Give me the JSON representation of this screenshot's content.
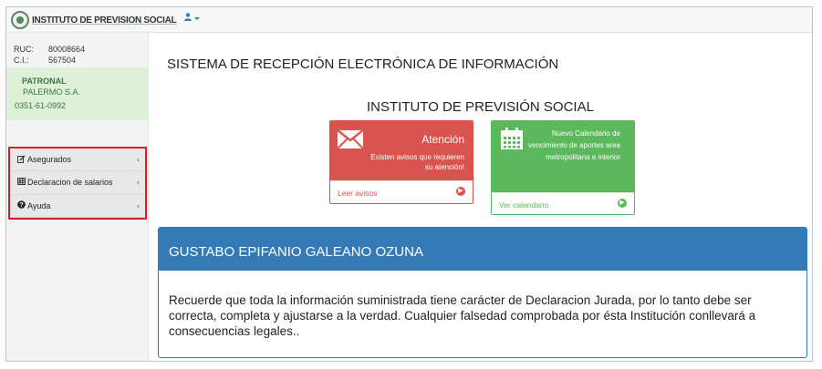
{
  "navbar": {
    "brand_text": "INSTITUTO DE PREVISION SOCIAL",
    "user_icon": "user-icon",
    "caret_icon": "caret-down-icon"
  },
  "sidebar": {
    "ruc_label": "RUC:",
    "ruc_value": "80008664",
    "ci_label": "C.I.:",
    "ci_value": "567504",
    "patronal_title": "PATRONAL",
    "patronal_name": "PALERMO S.A.",
    "patronal_phone": "0351-61-0992",
    "items": [
      {
        "label": "Asegurados",
        "icon": "edit-icon"
      },
      {
        "label": "Declaracion de salarios",
        "icon": "table-icon"
      },
      {
        "label": "Ayuda",
        "icon": "question-circle-icon"
      }
    ]
  },
  "main": {
    "system_title": "SISTEMA DE RECEPCIÓN ELECTRÓNICA DE INFORMACIÓN",
    "institute_title": "INSTITUTO DE PREVISIÓN SOCIAL",
    "cards": {
      "attention": {
        "title": "Atención",
        "subtitle": "Existen avisos que requieren su atención!",
        "link": "Leer avisos",
        "color": "#d9534f"
      },
      "calendar": {
        "subtitle": "Nuevo Calendario de vencimiento de aportes area metropolitana e interior",
        "link": "Ver calendario",
        "color": "#5cb85c"
      }
    },
    "panel": {
      "heading": "GUSTABO EPIFANIO GALEANO OZUNA",
      "body": "Recuerde que toda la información suministrada tiene carácter de Declaracion Jurada, por lo tanto debe ser correcta, completa y ajustarse a la verdad. Cualquier falsedad comprobada por ésta Institución conllevará a consecuencias legales..",
      "color": "#337ab7"
    }
  },
  "colors": {
    "sidebar_highlight_border": "#d62020",
    "patronal_bg": "#def0d8"
  }
}
